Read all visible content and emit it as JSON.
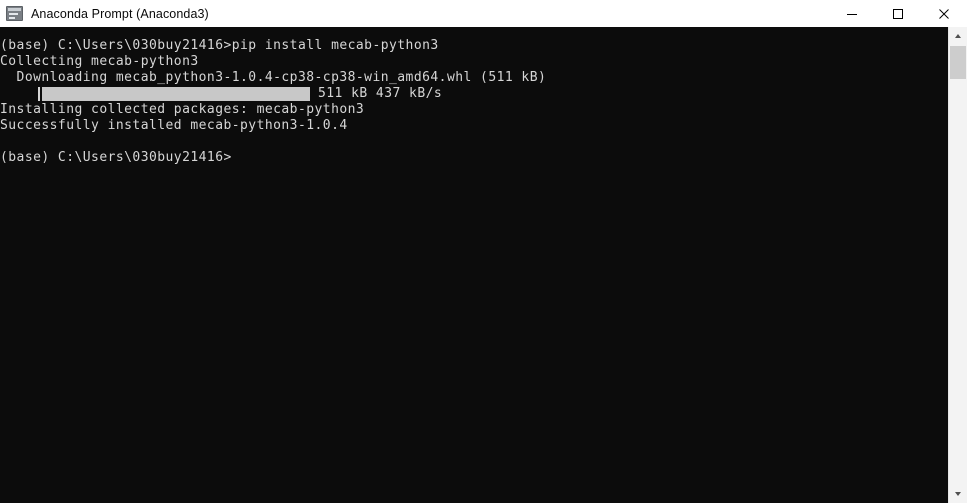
{
  "window": {
    "title": "Anaconda Prompt (Anaconda3)",
    "icon": "console-icon",
    "controls": {
      "minimize": "minimize-icon",
      "maximize": "maximize-icon",
      "close": "close-icon"
    },
    "colors": {
      "titlebar_bg": "#ffffff",
      "titlebar_text": "#0a0a0a",
      "console_bg": "#0c0c0c",
      "console_text": "#d6d6d6",
      "progress_fill": "#c8c8c8",
      "scrollbar_track": "#f3f3f3",
      "scrollbar_thumb": "#cdcdcd"
    }
  },
  "terminal": {
    "lines": [
      {
        "type": "text",
        "text": "(base) C:\\Users\\030buy21416>pip install mecab-python3"
      },
      {
        "type": "text",
        "text": "Collecting mecab-python3"
      },
      {
        "type": "text",
        "text": "  Downloading mecab_python3-1.0.4-cp38-cp38-win_amd64.whl (511 kB)"
      },
      {
        "type": "progress",
        "text": "511 kB 437 kB/s",
        "percent": 100
      },
      {
        "type": "text",
        "text": "Installing collected packages: mecab-python3"
      },
      {
        "type": "text",
        "text": "Successfully installed mecab-python3-1.0.4"
      },
      {
        "type": "text",
        "text": ""
      },
      {
        "type": "text",
        "text": "(base) C:\\Users\\030buy21416>"
      }
    ]
  },
  "scrollbar": {
    "up_arrow": "scroll-up-arrow-icon",
    "down_arrow": "scroll-down-arrow-icon",
    "thumb": "scrollbar-thumb"
  }
}
